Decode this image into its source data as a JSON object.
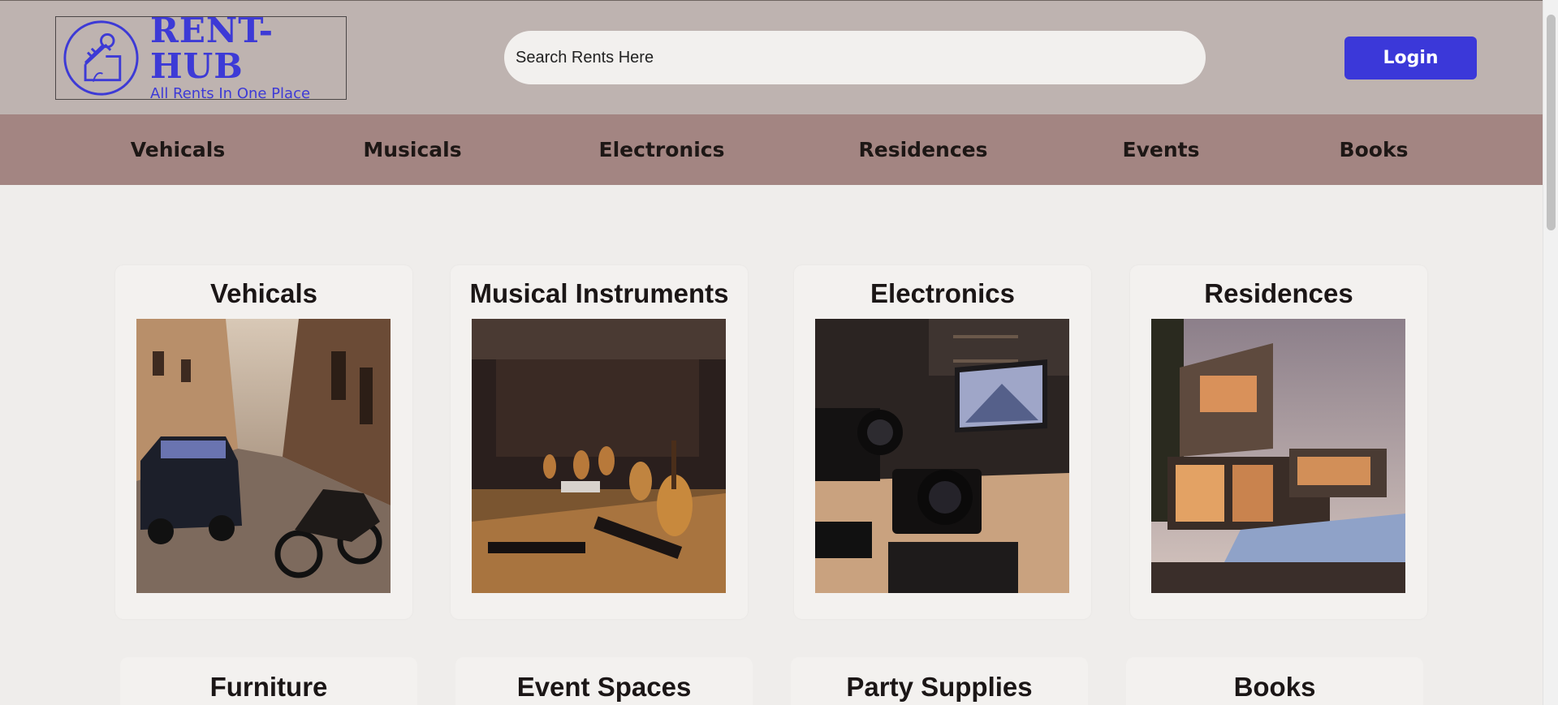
{
  "header": {
    "logo": {
      "title": "RENT-HUB",
      "tagline": "All Rents In One Place"
    },
    "search": {
      "placeholder": "Search Rents Here"
    },
    "login_label": "Login"
  },
  "nav": {
    "items": [
      {
        "label": "Vehicals"
      },
      {
        "label": "Musicals"
      },
      {
        "label": "Electronics"
      },
      {
        "label": "Residences"
      },
      {
        "label": "Events"
      },
      {
        "label": "Books"
      }
    ]
  },
  "categories": [
    {
      "title": "Vehicals",
      "image": "street-car-motorcycle-photo"
    },
    {
      "title": "Musical Instruments",
      "image": "instruments-stage-photo"
    },
    {
      "title": "Electronics",
      "image": "camera-monitor-desk-photo"
    },
    {
      "title": "Residences",
      "image": "modern-house-pool-photo"
    },
    {
      "title": "Furniture"
    },
    {
      "title": "Event Spaces"
    },
    {
      "title": "Party Supplies"
    },
    {
      "title": "Books"
    }
  ],
  "colors": {
    "header_bg": "#beb3b0",
    "nav_bg": "#a38582",
    "accent": "#3b38d9",
    "page_bg": "#efedeb"
  }
}
